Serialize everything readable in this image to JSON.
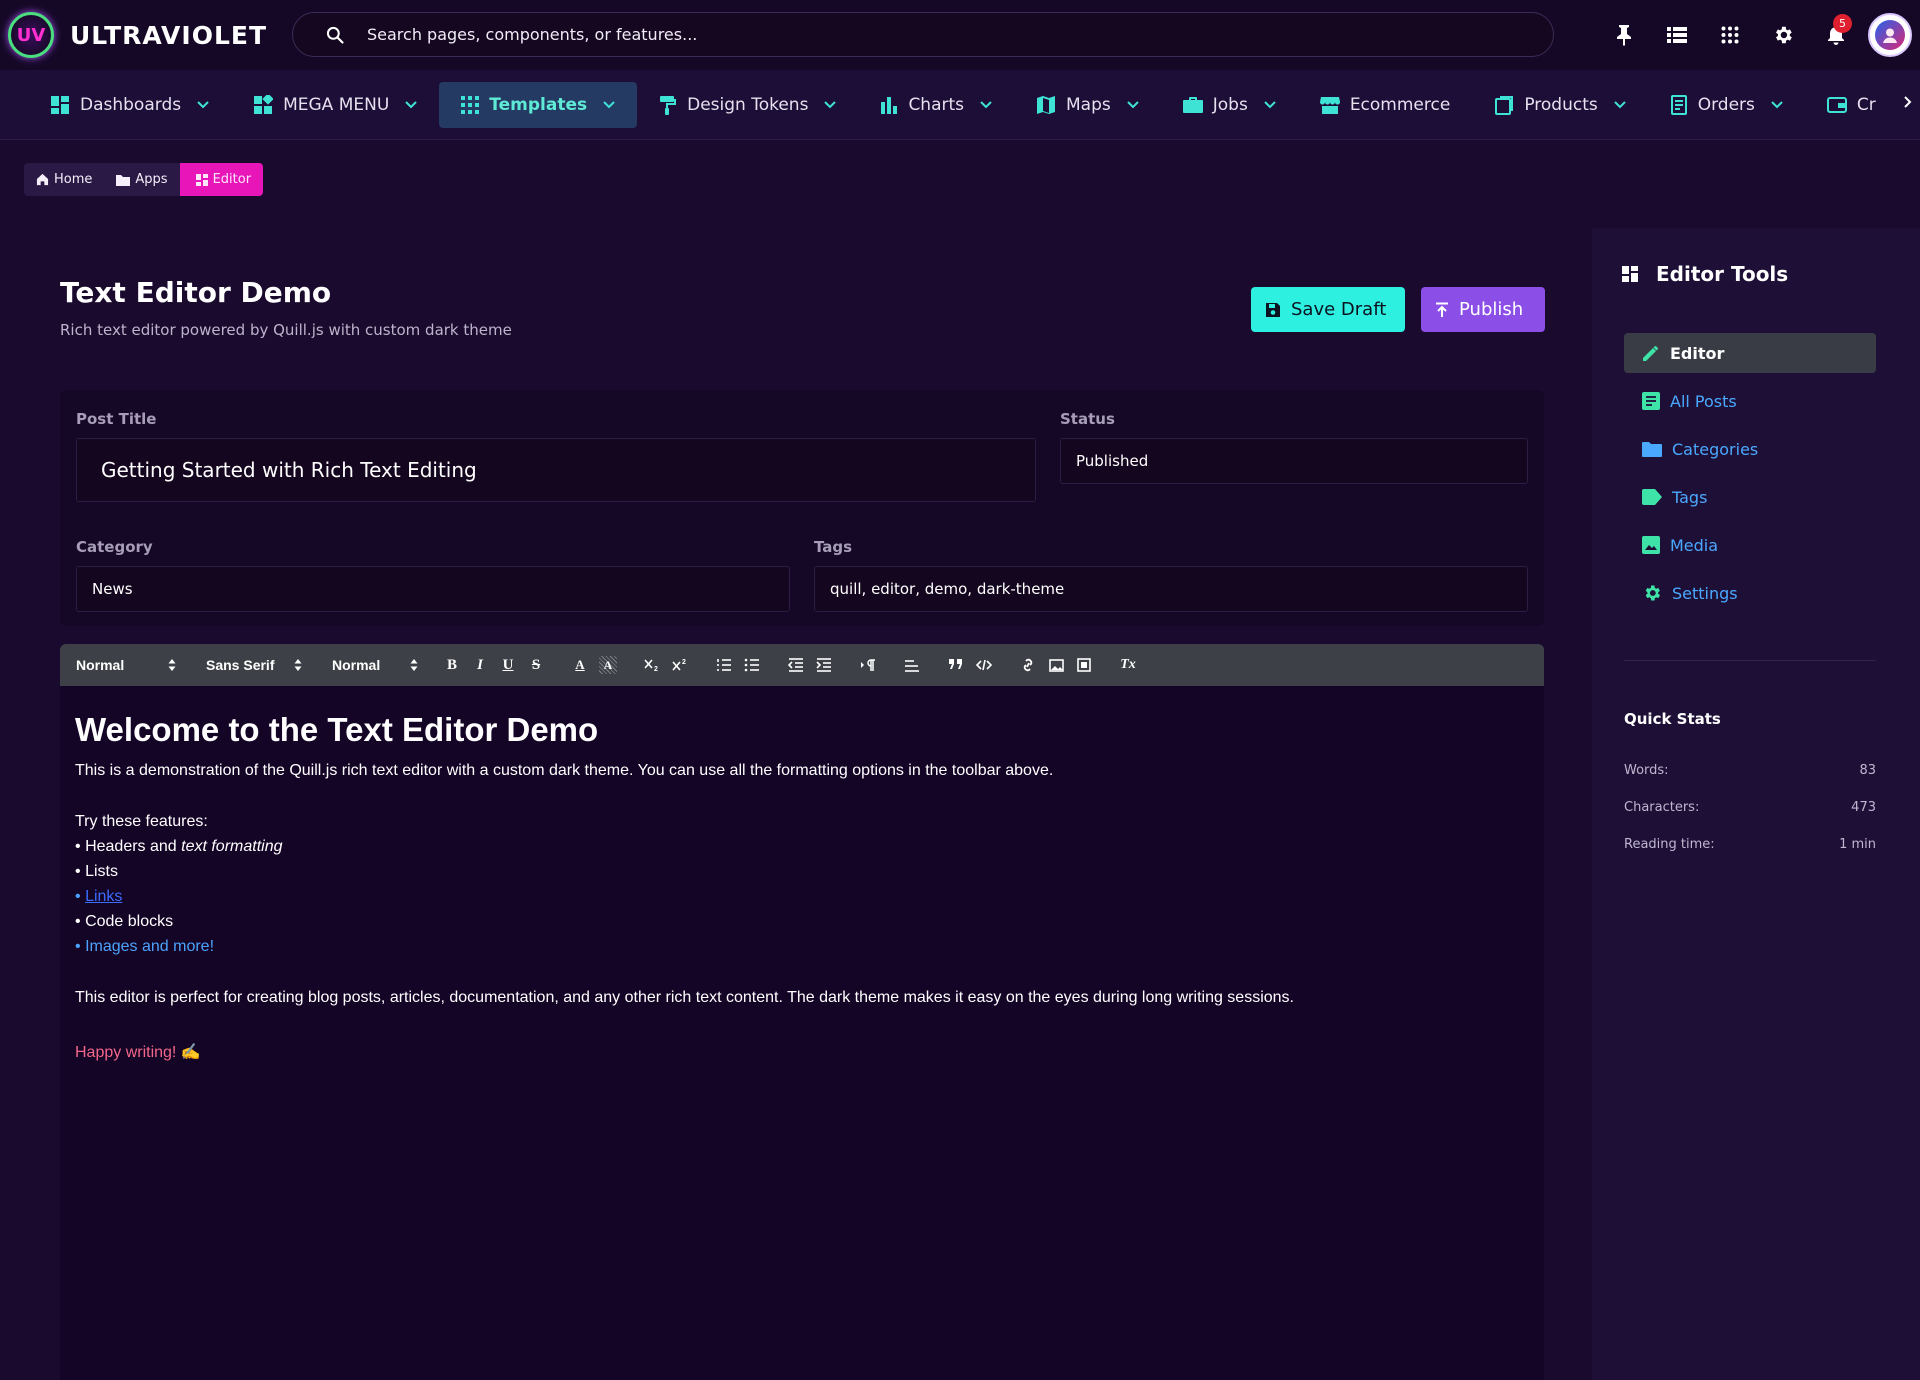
{
  "app": {
    "name": "ULTRAVIOLET",
    "logo_text": "UV"
  },
  "search": {
    "placeholder": "Search pages, components, or features..."
  },
  "header": {
    "notifications_count": "5"
  },
  "nav": [
    {
      "label": "Dashboards",
      "icon": "dashboard-icon",
      "has_dropdown": true
    },
    {
      "label": "MEGA MENU",
      "icon": "widgets-icon",
      "has_dropdown": true
    },
    {
      "label": "Templates",
      "icon": "grid-icon",
      "has_dropdown": true,
      "active": true
    },
    {
      "label": "Design Tokens",
      "icon": "paint-roller-icon",
      "has_dropdown": true
    },
    {
      "label": "Charts",
      "icon": "bar-chart-icon",
      "has_dropdown": true
    },
    {
      "label": "Maps",
      "icon": "map-icon",
      "has_dropdown": true
    },
    {
      "label": "Jobs",
      "icon": "briefcase-icon",
      "has_dropdown": true
    },
    {
      "label": "Ecommerce",
      "icon": "store-icon",
      "has_dropdown": false
    },
    {
      "label": "Products",
      "icon": "products-icon",
      "has_dropdown": true
    },
    {
      "label": "Orders",
      "icon": "receipt-icon",
      "has_dropdown": true
    },
    {
      "label": "Cr",
      "icon": "wallet-icon",
      "has_dropdown": false
    }
  ],
  "breadcrumb": {
    "home": "Home",
    "apps": "Apps",
    "current": "Editor"
  },
  "page": {
    "title": "Text Editor Demo",
    "subtitle": "Rich text editor powered by Quill.js with custom dark theme",
    "save_label": "Save Draft",
    "publish_label": "Publish"
  },
  "form": {
    "post_title_label": "Post Title",
    "post_title_value": "Getting Started with Rich Text Editing",
    "status_label": "Status",
    "status_value": "Published",
    "category_label": "Category",
    "category_value": "News",
    "tags_label": "Tags",
    "tags_value": "quill, editor, demo, dark-theme"
  },
  "toolbar": {
    "header_select": "Normal",
    "font_select": "Sans Serif",
    "size_select": "Normal",
    "bold": "B",
    "italic": "I",
    "underline": "U",
    "strike": "S",
    "color": "A",
    "background": "A",
    "clean": "Tx"
  },
  "editor": {
    "heading": "Welcome to the Text Editor Demo",
    "intro": "This is a demonstration of the Quill.js rich text editor with a custom dark theme. You can use all the formatting options in the toolbar above.",
    "features_title": "Try these features:",
    "bullet": "•",
    "item1_a": "Headers and ",
    "item1_b": "text formatting",
    "item2": "Lists",
    "item3": "Links",
    "item4": "Code blocks",
    "item5": "Images and more!",
    "outro": "This editor is perfect for creating blog posts, articles, documentation, and any other rich text content. The dark theme makes it easy on the eyes during long writing sessions.",
    "signoff": "Happy writing! ✍️"
  },
  "sidebar": {
    "title": "Editor Tools",
    "items": [
      {
        "label": "Editor",
        "icon": "pencil-icon",
        "active": true
      },
      {
        "label": "All Posts",
        "icon": "article-icon"
      },
      {
        "label": "Categories",
        "icon": "folder-icon"
      },
      {
        "label": "Tags",
        "icon": "tag-icon"
      },
      {
        "label": "Media",
        "icon": "image-icon"
      },
      {
        "label": "Settings",
        "icon": "gear-icon"
      }
    ],
    "stats_title": "Quick Stats",
    "stats": [
      {
        "label": "Words:",
        "value": "83"
      },
      {
        "label": "Characters:",
        "value": "473"
      },
      {
        "label": "Reading time:",
        "value": "1 min"
      }
    ]
  },
  "colors": {
    "background": "#1a0b2e",
    "accent_teal": "#2ef0e0",
    "accent_purple": "#8b4fe8",
    "accent_pink": "#e816b8",
    "link_blue": "#4aa8ff"
  }
}
